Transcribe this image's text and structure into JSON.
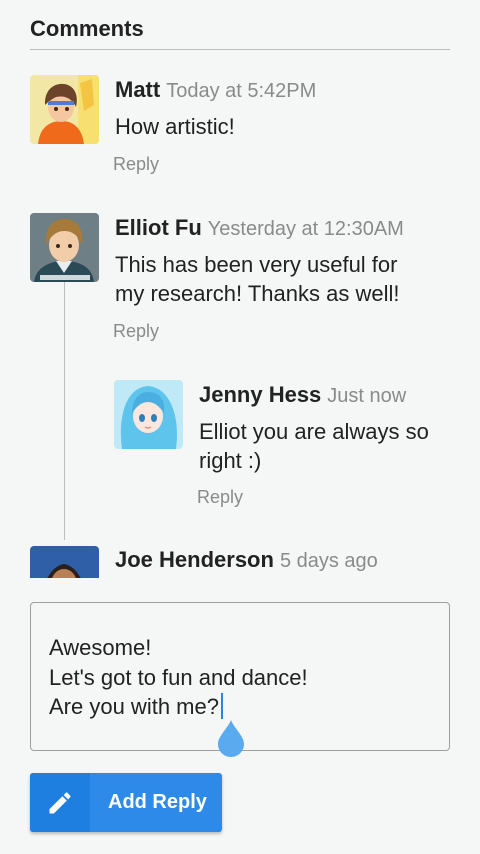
{
  "header": {
    "title": "Comments"
  },
  "comments": [
    {
      "name": "Matt",
      "time": "Today at 5:42PM",
      "lines": [
        "How artistic!"
      ],
      "reply": "Reply",
      "avatar_icon": "avatar-matt"
    },
    {
      "name": "Elliot Fu",
      "time": "Yesterday at 12:30AM",
      "lines": [
        "This has been very useful for",
        "my research! Thanks as well!"
      ],
      "reply": "Reply",
      "avatar_icon": "avatar-elliot"
    },
    {
      "name": "Jenny Hess",
      "time": "Just now",
      "lines": [
        "Elliot you are always so",
        "right :)"
      ],
      "reply": "Reply",
      "avatar_icon": "avatar-jenny"
    },
    {
      "name": "Joe Henderson",
      "time": "5 days ago",
      "avatar_icon": "avatar-joe"
    }
  ],
  "reply_box": {
    "lines": [
      "Awesome!",
      "Let's got to fun and dance!",
      "Are you with me?"
    ]
  },
  "add_reply_button": {
    "label": "Add Reply",
    "icon": "pencil-icon"
  },
  "colors": {
    "accent": "#2d8ae8",
    "accent_dark": "#1f7fe0",
    "caret": "#2f80ed",
    "muted_text": "#8a8a8a"
  }
}
